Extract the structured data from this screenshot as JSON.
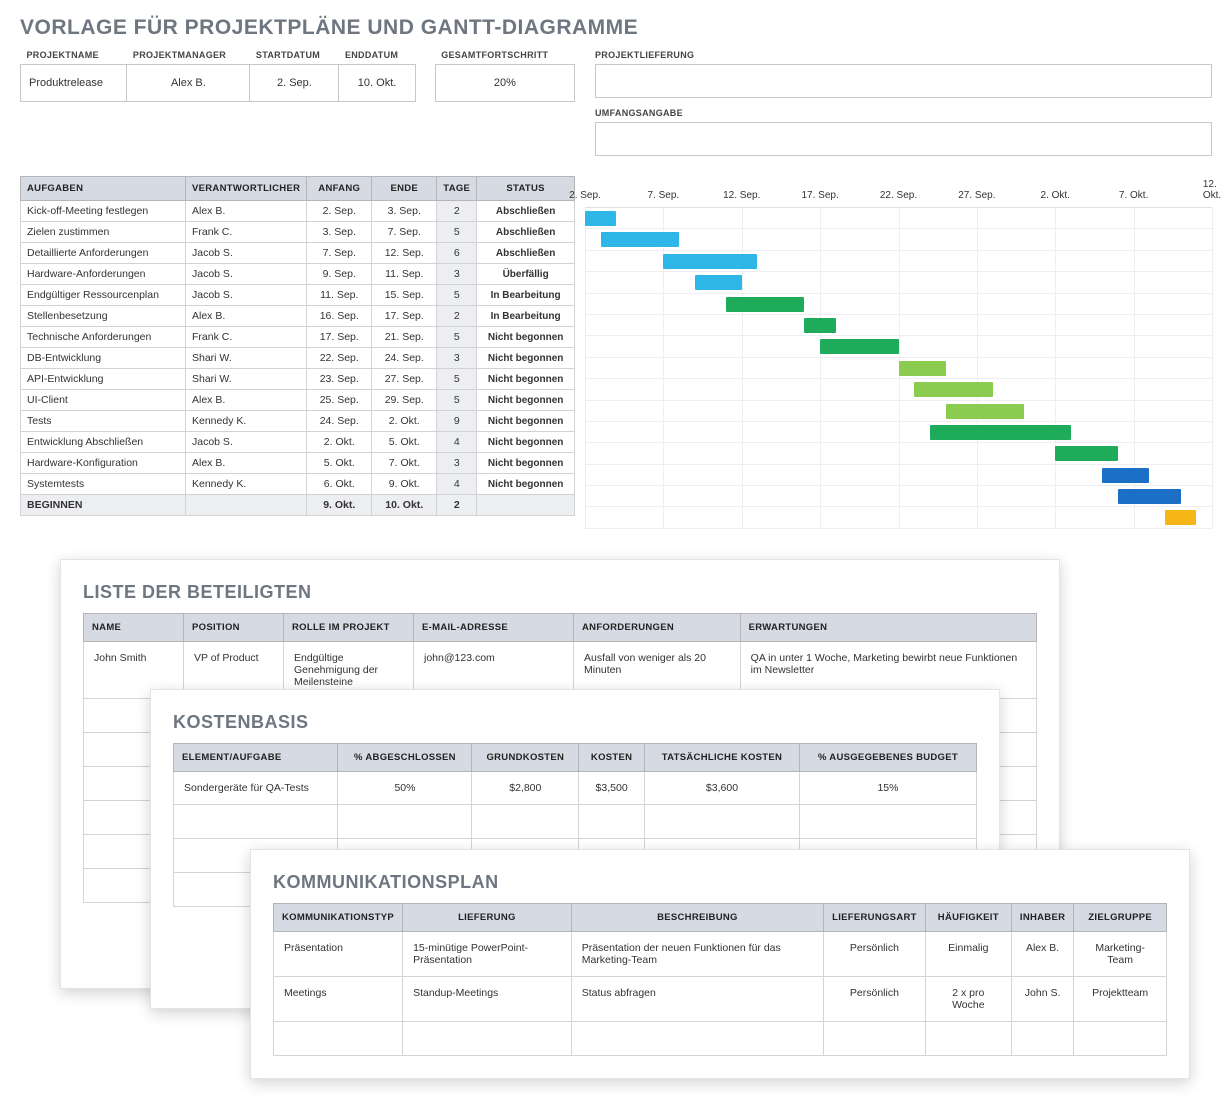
{
  "title": "VORLAGE FÜR PROJEKTPLÄNE UND GANTT-DIAGRAMME",
  "meta_headers": {
    "name": "PROJEKTNAME",
    "manager": "PROJEKTMANAGER",
    "start": "STARTDATUM",
    "end": "ENDDATUM",
    "progress": "GESAMTFORTSCHRITT",
    "delivery": "PROJEKTLIEFERUNG",
    "scope": "UMFANGSANGABE"
  },
  "meta": {
    "name": "Produktrelease",
    "manager": "Alex B.",
    "start": "2. Sep.",
    "end": "10. Okt.",
    "progress": "20%"
  },
  "task_headers": {
    "task": "AUFGABEN",
    "owner": "VERANTWORTLICHER",
    "start": "ANFANG",
    "end": "ENDE",
    "days": "TAGE",
    "status": "STATUS"
  },
  "tasks": [
    {
      "name": "Kick-off-Meeting festlegen",
      "owner": "Alex B.",
      "start": "2. Sep.",
      "end": "3. Sep.",
      "days": "2",
      "status": "Abschließen",
      "bar_start": 0,
      "bar_span": 2,
      "color": "c-blue"
    },
    {
      "name": "Zielen zustimmen",
      "owner": "Frank C.",
      "start": "3. Sep.",
      "end": "7. Sep.",
      "days": "5",
      "status": "Abschließen",
      "bar_start": 1,
      "bar_span": 5,
      "color": "c-blue"
    },
    {
      "name": "Detaillierte Anforderungen",
      "owner": "Jacob S.",
      "start": "7. Sep.",
      "end": "12. Sep.",
      "days": "6",
      "status": "Abschließen",
      "bar_start": 5,
      "bar_span": 6,
      "color": "c-blue"
    },
    {
      "name": "Hardware-Anforderungen",
      "owner": "Jacob S.",
      "start": "9. Sep.",
      "end": "11. Sep.",
      "days": "3",
      "status": "Überfällig",
      "bar_start": 7,
      "bar_span": 3,
      "color": "c-blue"
    },
    {
      "name": "Endgültiger Ressourcenplan",
      "owner": "Jacob S.",
      "start": "11. Sep.",
      "end": "15. Sep.",
      "days": "5",
      "status": "In Bearbeitung",
      "bar_start": 9,
      "bar_span": 5,
      "color": "c-green"
    },
    {
      "name": "Stellenbesetzung",
      "owner": "Alex B.",
      "start": "16. Sep.",
      "end": "17. Sep.",
      "days": "2",
      "status": "In Bearbeitung",
      "bar_start": 14,
      "bar_span": 2,
      "color": "c-green"
    },
    {
      "name": "Technische Anforderungen",
      "owner": "Frank C.",
      "start": "17. Sep.",
      "end": "21. Sep.",
      "days": "5",
      "status": "Nicht begonnen",
      "bar_start": 15,
      "bar_span": 5,
      "color": "c-green"
    },
    {
      "name": "DB-Entwicklung",
      "owner": "Shari W.",
      "start": "22. Sep.",
      "end": "24. Sep.",
      "days": "3",
      "status": "Nicht begonnen",
      "bar_start": 20,
      "bar_span": 3,
      "color": "c-lime"
    },
    {
      "name": "API-Entwicklung",
      "owner": "Shari W.",
      "start": "23. Sep.",
      "end": "27. Sep.",
      "days": "5",
      "status": "Nicht begonnen",
      "bar_start": 21,
      "bar_span": 5,
      "color": "c-lime"
    },
    {
      "name": "UI-Client",
      "owner": "Alex B.",
      "start": "25. Sep.",
      "end": "29. Sep.",
      "days": "5",
      "status": "Nicht begonnen",
      "bar_start": 23,
      "bar_span": 5,
      "color": "c-lime"
    },
    {
      "name": "Tests",
      "owner": "Kennedy K.",
      "start": "24. Sep.",
      "end": "2. Okt.",
      "days": "9",
      "status": "Nicht begonnen",
      "bar_start": 22,
      "bar_span": 9,
      "color": "c-green"
    },
    {
      "name": "Entwicklung Abschließen",
      "owner": "Jacob S.",
      "start": "2. Okt.",
      "end": "5. Okt.",
      "days": "4",
      "status": "Nicht begonnen",
      "bar_start": 30,
      "bar_span": 4,
      "color": "c-green"
    },
    {
      "name": "Hardware-Konfiguration",
      "owner": "Alex B.",
      "start": "5. Okt.",
      "end": "7. Okt.",
      "days": "3",
      "status": "Nicht begonnen",
      "bar_start": 33,
      "bar_span": 3,
      "color": "c-dblue"
    },
    {
      "name": "Systemtests",
      "owner": "Kennedy K.",
      "start": "6. Okt.",
      "end": "9. Okt.",
      "days": "4",
      "status": "Nicht begonnen",
      "bar_start": 34,
      "bar_span": 4,
      "color": "c-dblue"
    }
  ],
  "summary": {
    "name": "BEGINNEN",
    "owner": "",
    "start": "9. Okt.",
    "end": "10. Okt.",
    "days": "2",
    "status": "",
    "bar_start": 37,
    "bar_span": 2,
    "color": "c-orange"
  },
  "gantt_dates": [
    "2. Sep.",
    "7. Sep.",
    "12. Sep.",
    "17. Sep.",
    "22. Sep.",
    "27. Sep.",
    "2. Okt.",
    "7. Okt.",
    "12. Okt."
  ],
  "chart_data": {
    "type": "bar",
    "title": "Gantt",
    "x_axis_dates": [
      "2. Sep.",
      "7. Sep.",
      "12. Sep.",
      "17. Sep.",
      "22. Sep.",
      "27. Sep.",
      "2. Okt.",
      "7. Okt.",
      "12. Okt."
    ],
    "total_days": 40,
    "colors": {
      "c-blue": "#2eb6e8",
      "c-green": "#1eac5a",
      "c-lime": "#8bcb4f",
      "c-dblue": "#1b6fc4",
      "c-orange": "#f7b618"
    },
    "bars": [
      {
        "label": "Kick-off-Meeting festlegen",
        "start": 0,
        "span": 2,
        "color": "c-blue"
      },
      {
        "label": "Zielen zustimmen",
        "start": 1,
        "span": 5,
        "color": "c-blue"
      },
      {
        "label": "Detaillierte Anforderungen",
        "start": 5,
        "span": 6,
        "color": "c-blue"
      },
      {
        "label": "Hardware-Anforderungen",
        "start": 7,
        "span": 3,
        "color": "c-blue"
      },
      {
        "label": "Endgültiger Ressourcenplan",
        "start": 9,
        "span": 5,
        "color": "c-green"
      },
      {
        "label": "Stellenbesetzung",
        "start": 14,
        "span": 2,
        "color": "c-green"
      },
      {
        "label": "Technische Anforderungen",
        "start": 15,
        "span": 5,
        "color": "c-green"
      },
      {
        "label": "DB-Entwicklung",
        "start": 20,
        "span": 3,
        "color": "c-lime"
      },
      {
        "label": "API-Entwicklung",
        "start": 21,
        "span": 5,
        "color": "c-lime"
      },
      {
        "label": "UI-Client",
        "start": 23,
        "span": 5,
        "color": "c-lime"
      },
      {
        "label": "Tests",
        "start": 22,
        "span": 9,
        "color": "c-green"
      },
      {
        "label": "Entwicklung Abschließen",
        "start": 30,
        "span": 4,
        "color": "c-green"
      },
      {
        "label": "Hardware-Konfiguration",
        "start": 33,
        "span": 3,
        "color": "c-dblue"
      },
      {
        "label": "Systemtests",
        "start": 34,
        "span": 4,
        "color": "c-dblue"
      },
      {
        "label": "BEGINNEN",
        "start": 37,
        "span": 2,
        "color": "c-orange"
      }
    ]
  },
  "stakeholders": {
    "title": "LISTE DER BETEILIGTEN",
    "headers": {
      "name": "NAME",
      "position": "POSITION",
      "role": "ROLLE IM PROJEKT",
      "email": "E-MAIL-ADRESSE",
      "req": "ANFORDERUNGEN",
      "exp": "ERWARTUNGEN"
    },
    "rows": [
      {
        "name": "John Smith",
        "position": "VP of Product",
        "role": "Endgültige Genehmigung der Meilensteine",
        "email": "john@123.com",
        "req": "Ausfall von weniger als 20 Minuten",
        "exp": "QA in unter 1 Woche, Marketing bewirbt neue Funktionen im Newsletter"
      }
    ]
  },
  "cost": {
    "title": "KOSTENBASIS",
    "headers": {
      "item": "ELEMENT/AUFGABE",
      "pct": "% ABGESCHLOSSEN",
      "base": "GRUNDKOSTEN",
      "cost": "KOSTEN",
      "actual": "TATSÄCHLICHE KOSTEN",
      "spent": "% AUSGEGEBENES BUDGET"
    },
    "rows": [
      {
        "item": "Sondergeräte für QA-Tests",
        "pct": "50%",
        "base": "$2,800",
        "cost": "$3,500",
        "actual": "$3,600",
        "spent": "15%"
      }
    ]
  },
  "comm": {
    "title": "KOMMUNIKATIONSPLAN",
    "headers": {
      "type": "KOMMUNIKATIONSTYP",
      "delivery": "LIEFERUNG",
      "desc": "BESCHREIBUNG",
      "mode": "LIEFERUNGSART",
      "freq": "HÄUFIGKEIT",
      "owner": "INHABER",
      "aud": "ZIELGRUPPE"
    },
    "rows": [
      {
        "type": "Präsentation",
        "delivery": "15-minütige PowerPoint-Präsentation",
        "desc": "Präsentation der neuen Funktionen für das Marketing-Team",
        "mode": "Persönlich",
        "freq": "Einmalig",
        "owner": "Alex B.",
        "aud": "Marketing-Team"
      },
      {
        "type": "Meetings",
        "delivery": "Standup-Meetings",
        "desc": "Status abfragen",
        "mode": "Persönlich",
        "freq": "2 x pro Woche",
        "owner": "John S.",
        "aud": "Projektteam"
      }
    ]
  }
}
